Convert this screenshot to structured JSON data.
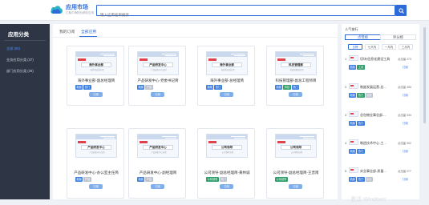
{
  "header": {
    "brand_name": "应用市场",
    "brand_subtitle": "汇聚中海物业精彩应用",
    "search_placeholder": "输入应用名称搜索"
  },
  "sidebar": {
    "title": "应用分类",
    "items": [
      {
        "label": "全部 (65)",
        "active": true
      },
      {
        "label": "业务应用分类 (37)",
        "active": false
      },
      {
        "label": "部门应用分类 (28)",
        "active": false
      }
    ]
  },
  "tabs": [
    {
      "label": "我的订阅",
      "active": false
    },
    {
      "label": "全部应用",
      "active": true
    }
  ],
  "cards": [
    {
      "thumb_label": "海外事业部",
      "thumb_sub": "海外事业部应用",
      "title": "海外事业部-副总经理简",
      "tags": [
        {
          "text": "新版",
          "color": "blue"
        },
        {
          "text": "热门",
          "color": "blue"
        }
      ],
      "button": "订阅"
    },
    {
      "thumb_label": "产品研发中心",
      "thumb_sub": "产品研发中心应用",
      "title": "产品研发中心-党委书记简",
      "tags": [
        {
          "text": "新版",
          "color": "blue"
        },
        {
          "text": "产品",
          "color": "gray"
        }
      ],
      "button": "订阅"
    },
    {
      "thumb_label": "海外事业部",
      "thumb_sub": "海外事业部应用",
      "title": "海外事业部-总经理简",
      "tags": [
        {
          "text": "新版",
          "color": "blue"
        },
        {
          "text": "热门",
          "color": "blue"
        }
      ],
      "button": "订阅"
    },
    {
      "thumb_label": "科技管理部",
      "thumb_sub": "科技管理部应用",
      "title": "科技管理部-副总工程师简",
      "tags": [
        {
          "text": "新版",
          "color": "blue"
        },
        {
          "text": "科技",
          "color": "green"
        },
        {
          "text": "热门",
          "color": "blue"
        }
      ],
      "button": "订阅"
    },
    {
      "thumb_label": "产品研发中心",
      "thumb_sub": "产品研发中心应用",
      "title": "产品研发中心-办公室主任简",
      "tags": [
        {
          "text": "新版",
          "color": "blue"
        },
        {
          "text": "产品",
          "color": "gray"
        }
      ],
      "button": "订阅"
    },
    {
      "thumb_label": "产品研发中心",
      "thumb_sub": "产品研发中心应用",
      "title": "产品研发中心-副经理简",
      "tags": [
        {
          "text": "新版",
          "color": "blue"
        },
        {
          "text": "产品",
          "color": "gray"
        }
      ],
      "button": "订阅"
    },
    {
      "thumb_label": "公司领导",
      "thumb_sub": "公司领导应用",
      "title": "公司领导-副总经理简-黄林诚",
      "tags": [
        {
          "text": "公司领导",
          "color": "green"
        },
        {
          "text": "热门",
          "color": "gray"
        }
      ],
      "button": "订阅"
    },
    {
      "thumb_label": "公司领导",
      "thumb_sub": "公司领导应用",
      "title": "公司领导-副总经理简-王晋南",
      "tags": [
        {
          "text": "公司领导",
          "color": "green"
        }
      ],
      "button": "订阅"
    }
  ],
  "right_panel": {
    "title": "人气排行",
    "tabs": [
      {
        "label": "点赞榜",
        "active": true
      },
      {
        "label": "评分榜",
        "active": false
      }
    ],
    "periods": [
      {
        "label": "日榜",
        "active": true
      },
      {
        "label": "七天内",
        "active": false
      },
      {
        "label": "一月内",
        "active": false
      },
      {
        "label": "三月内",
        "active": false
      }
    ],
    "items": [
      {
        "rank": "1",
        "name": "切块/信息化建设工具",
        "views": "点击量 273",
        "tags": [
          {
            "text": "新版",
            "color": "blue"
          },
          {
            "text": "工具",
            "color": "green"
          }
        ],
        "action": "订阅"
      },
      {
        "rank": "2",
        "name": "制度发展运营-总...",
        "views": "点击量 453",
        "tags": [
          {
            "text": "新版",
            "color": "blue"
          },
          {
            "text": "热门",
            "color": "green"
          },
          {
            "text": "运营",
            "color": "gray"
          }
        ],
        "action": "订阅"
      },
      {
        "rank": "3",
        "name": "总包物业事业部-...",
        "views": "点击量 334",
        "tags": [
          {
            "text": "新版",
            "color": "blue"
          },
          {
            "text": "热门",
            "color": "blue"
          }
        ],
        "action": "订阅"
      },
      {
        "rank": "4",
        "name": "制造技术中心-工...",
        "views": "点击量 302",
        "tags": [
          {
            "text": "新版",
            "color": "blue"
          },
          {
            "text": "热门",
            "color": "blue"
          }
        ],
        "action": "订阅"
      },
      {
        "rank": "5",
        "name": "实业事业部-质量...",
        "views": "点击量 277",
        "tags": [
          {
            "text": "新版",
            "color": "blue"
          },
          {
            "text": "热门",
            "color": "blue"
          },
          {
            "text": "实业",
            "color": "gray"
          }
        ],
        "action": "订阅"
      }
    ]
  },
  "watermark": "激活 Windows"
}
